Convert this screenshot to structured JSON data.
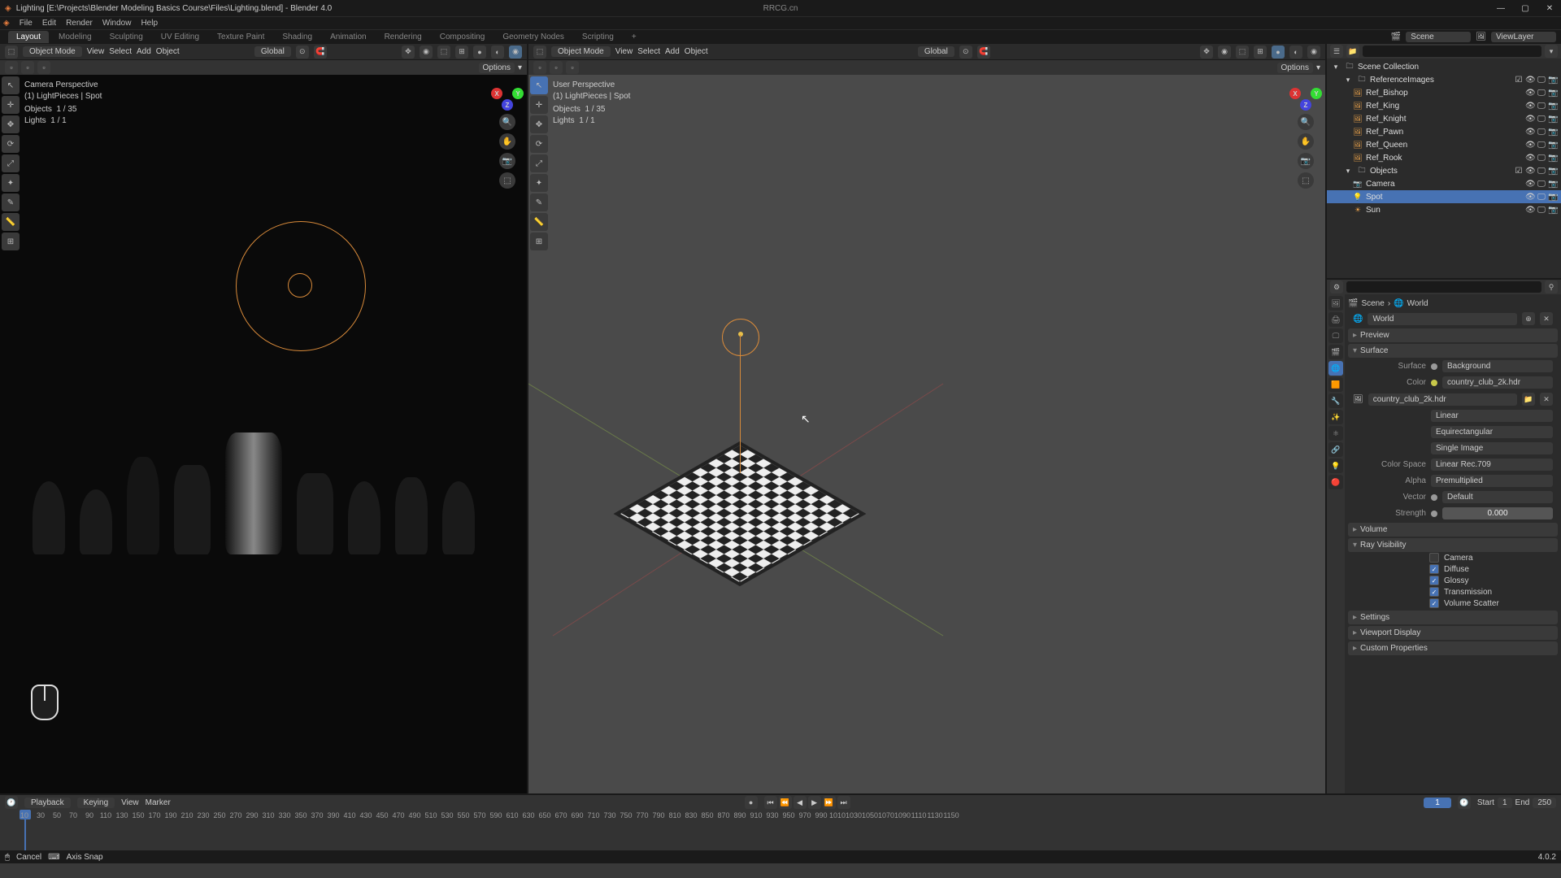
{
  "titlebar": {
    "app_icon": "◈",
    "title": "Lighting [E:\\Projects\\Blender Modeling Basics Course\\Files\\Lighting.blend] - Blender 4.0",
    "center_text": "RRCG.cn"
  },
  "menubar": [
    "File",
    "Edit",
    "Render",
    "Window",
    "Help"
  ],
  "workspace_tabs": [
    "Layout",
    "Modeling",
    "Sculpting",
    "UV Editing",
    "Texture Paint",
    "Shading",
    "Animation",
    "Rendering",
    "Compositing",
    "Geometry Nodes",
    "Scripting",
    "+"
  ],
  "workspace_active": "Layout",
  "scene": {
    "label": "Scene",
    "view_layer": "ViewLayer"
  },
  "vp_left": {
    "mode": "Object Mode",
    "menus": [
      "View",
      "Select",
      "Add",
      "Object"
    ],
    "orient": "Global",
    "overlay_title": "Camera Perspective",
    "overlay_sub": "(1) LightPieces | Spot",
    "stats1_label": "Objects",
    "stats1": "1 / 35",
    "stats2_label": "Lights",
    "stats2": "1 / 1",
    "options": "Options"
  },
  "vp_right": {
    "mode": "Object Mode",
    "menus": [
      "View",
      "Select",
      "Add",
      "Object"
    ],
    "orient": "Global",
    "overlay_title": "User Perspective",
    "overlay_sub": "(1) LightPieces | Spot",
    "stats1_label": "Objects",
    "stats1": "1 / 35",
    "stats2_label": "Lights",
    "stats2": "1 / 1",
    "options": "Options"
  },
  "outliner": {
    "root": "Scene Collection",
    "items": [
      {
        "indent": 1,
        "icon": "▸",
        "type": "coll",
        "label": "ReferenceImages"
      },
      {
        "indent": 2,
        "icon": "",
        "type": "obj",
        "label": "Ref_Bishop"
      },
      {
        "indent": 2,
        "icon": "",
        "type": "obj",
        "label": "Ref_King"
      },
      {
        "indent": 2,
        "icon": "",
        "type": "obj",
        "label": "Ref_Knight"
      },
      {
        "indent": 2,
        "icon": "",
        "type": "obj",
        "label": "Ref_Pawn"
      },
      {
        "indent": 2,
        "icon": "",
        "type": "obj",
        "label": "Ref_Queen"
      },
      {
        "indent": 2,
        "icon": "",
        "type": "obj",
        "label": "Ref_Rook"
      },
      {
        "indent": 1,
        "icon": "▸",
        "type": "coll",
        "label": "Objects"
      },
      {
        "indent": 2,
        "icon": "",
        "type": "cam",
        "label": "Camera"
      },
      {
        "indent": 2,
        "icon": "",
        "type": "light",
        "label": "Spot",
        "selected": true
      },
      {
        "indent": 2,
        "icon": "",
        "type": "light",
        "label": "Sun"
      }
    ]
  },
  "props": {
    "breadcrumb_scene": "Scene",
    "breadcrumb_world": "World",
    "world_name": "World",
    "panel_preview": "Preview",
    "panel_surface": "Surface",
    "surface_label": "Surface",
    "surface_value": "Background",
    "color_label": "Color",
    "color_value": "country_club_2k.hdr",
    "image_value": "country_club_2k.hdr",
    "interp": "Linear",
    "projection": "Equirectangular",
    "extension": "Single Image",
    "colorspace_label": "Color Space",
    "colorspace_value": "Linear Rec.709",
    "alpha_label": "Alpha",
    "alpha_value": "Premultiplied",
    "vector_label": "Vector",
    "vector_value": "Default",
    "strength_label": "Strength",
    "strength_value": "0.000",
    "panel_volume": "Volume",
    "panel_ray": "Ray Visibility",
    "ray_camera": "Camera",
    "ray_diffuse": "Diffuse",
    "ray_glossy": "Glossy",
    "ray_trans": "Transmission",
    "ray_scatter": "Volume Scatter",
    "panel_settings": "Settings",
    "panel_vpdisp": "Viewport Display",
    "panel_custom": "Custom Properties"
  },
  "timeline": {
    "menus": [
      "Playback",
      "Keying",
      "View",
      "Marker"
    ],
    "frame": "1",
    "start_label": "Start",
    "start": "1",
    "end_label": "End",
    "end": "250",
    "ticks": [
      "10",
      "30",
      "50",
      "70",
      "90",
      "110",
      "130",
      "150",
      "170",
      "190",
      "210",
      "230",
      "250",
      "270",
      "290",
      "310",
      "330",
      "350",
      "370",
      "390",
      "410",
      "430",
      "450",
      "470",
      "490",
      "510",
      "530",
      "550",
      "570",
      "590",
      "610",
      "630",
      "650",
      "670",
      "690",
      "710",
      "730",
      "750",
      "770",
      "790",
      "810",
      "830",
      "850",
      "870",
      "890",
      "910",
      "930",
      "950",
      "970",
      "990",
      "1010",
      "1030",
      "1050",
      "1070",
      "1090",
      "1110",
      "1130",
      "1150"
    ]
  },
  "statusbar": {
    "left1": "Cancel",
    "left2": "Axis Snap",
    "version": "4.0.2"
  }
}
